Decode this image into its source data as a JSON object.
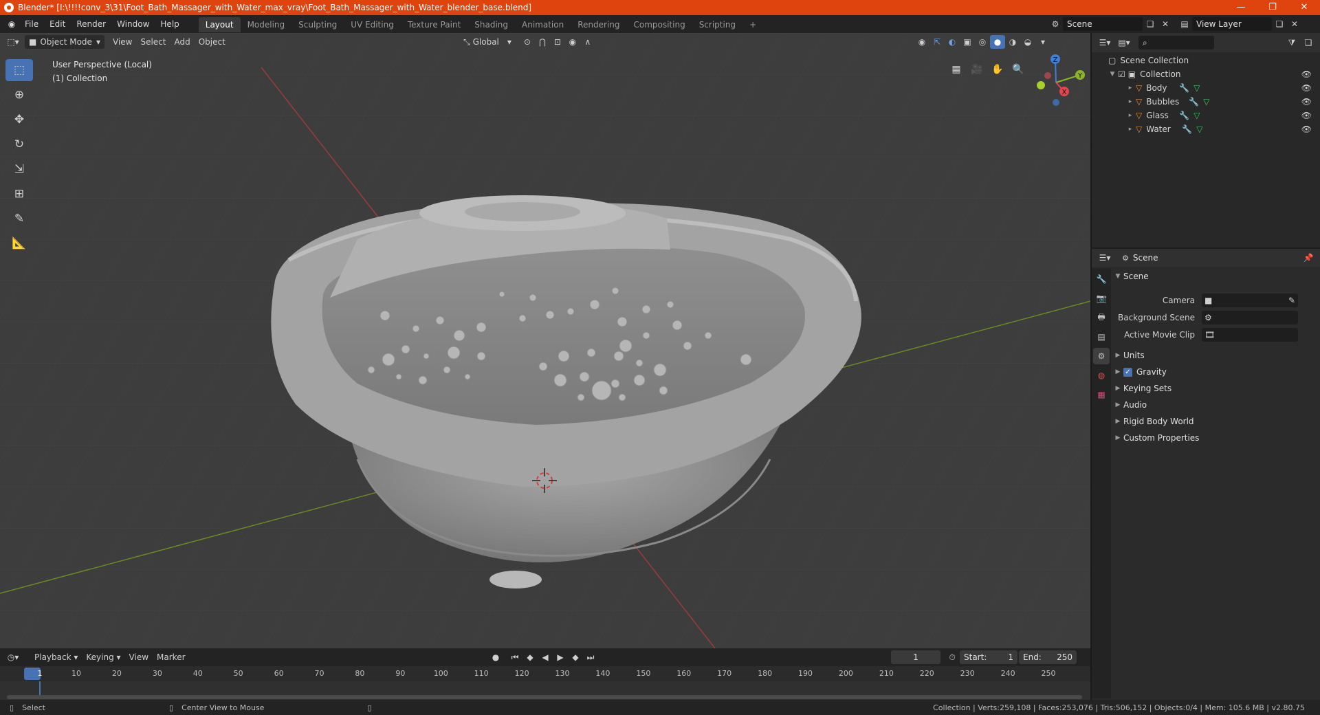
{
  "window": {
    "title": "Blender* [I:\\!!!!conv_3\\31\\Foot_Bath_Massager_with_Water_max_vray\\Foot_Bath_Massager_with_Water_blender_base.blend]",
    "buttons": [
      "—",
      "❐",
      "✕"
    ]
  },
  "menubar": {
    "menus": [
      "File",
      "Edit",
      "Render",
      "Window",
      "Help"
    ],
    "workspaces": [
      "Layout",
      "Modeling",
      "Sculpting",
      "UV Editing",
      "Texture Paint",
      "Shading",
      "Animation",
      "Rendering",
      "Compositing",
      "Scripting"
    ],
    "add_workspace": "+",
    "scene_label": "Scene",
    "view_layer_label": "View Layer"
  },
  "viewport": {
    "mode": "Object Mode",
    "menus": [
      "View",
      "Select",
      "Add",
      "Object"
    ],
    "transform_orientation": "Global",
    "info_line1": "User Perspective (Local)",
    "info_line2": "(1) Collection",
    "gizmo_axes": {
      "z": "Z",
      "y": "Y",
      "x": "X"
    }
  },
  "toolbar": {
    "tools": [
      "select-box",
      "cursor",
      "move",
      "rotate",
      "scale",
      "transform",
      "annotate",
      "measure"
    ]
  },
  "timeline": {
    "menus": [
      "Playback",
      "Keying",
      "View",
      "Marker"
    ],
    "current_frame": "1",
    "start_label": "Start:",
    "start": "1",
    "end_label": "End:",
    "end": "250",
    "ticks": [
      "1",
      "10",
      "20",
      "30",
      "40",
      "50",
      "60",
      "70",
      "80",
      "90",
      "100",
      "110",
      "120",
      "130",
      "140",
      "150",
      "160",
      "170",
      "180",
      "190",
      "200",
      "210",
      "220",
      "230",
      "240",
      "250"
    ]
  },
  "statusbar": {
    "left_action": "Select",
    "mid_action": "Center View to Mouse",
    "stats": "Collection | Verts:259,108 | Faces:253,076 | Tris:506,152 | Objects:0/4 | Mem: 105.6 MB | v2.80.75"
  },
  "outliner": {
    "root": "Scene Collection",
    "collection": "Collection",
    "objects": [
      "Body",
      "Bubbles",
      "Glass",
      "Water"
    ]
  },
  "properties": {
    "header": "Scene",
    "panel": "Scene",
    "fields": [
      {
        "label": "Camera",
        "value": ""
      },
      {
        "label": "Background Scene",
        "value": ""
      },
      {
        "label": "Active Movie Clip",
        "value": ""
      }
    ],
    "sections": [
      "Units",
      "Gravity",
      "Keying Sets",
      "Audio",
      "Rigid Body World",
      "Custom Properties"
    ],
    "gravity_checked": true
  },
  "colors": {
    "titlebar": "#e0440e",
    "accent": "#4772b3",
    "viewport_bg": "#3d3d3d",
    "axis_x": "#e5434f",
    "axis_y": "#8bb42b",
    "axis_z": "#3f7fd6",
    "object_icon": "#e08a3c",
    "mesh_icon": "#39c35a"
  }
}
